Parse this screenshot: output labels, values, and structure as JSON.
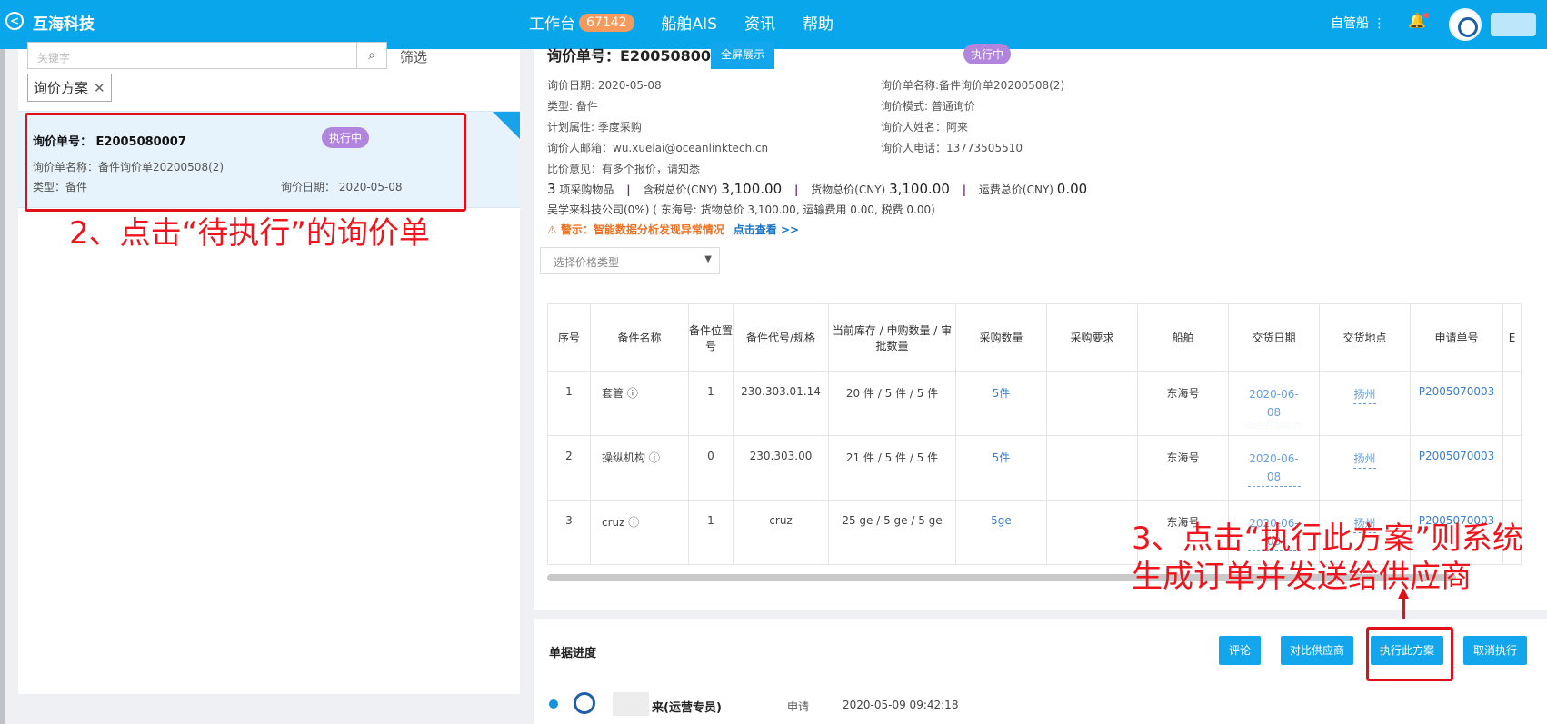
{
  "topbar": {
    "brand": "互海科技",
    "nav": [
      {
        "label": "工作台",
        "badge": "67142"
      },
      {
        "label": "船舶AIS"
      },
      {
        "label": "资讯"
      },
      {
        "label": "帮助"
      }
    ],
    "self_ship": "自管船 ⋮"
  },
  "left": {
    "search_placeholder": "关键字",
    "filter_label": "筛选",
    "tag_label": "询价方案",
    "card": {
      "no": "询价单号： E2005080007",
      "status": "执行中",
      "name": "询价单名称：备件询价单20200508(2)",
      "type": "类型：备件",
      "date": "询价日期：  2020-05-08"
    }
  },
  "annotations": {
    "step2": "2、点击“待执行”的询价单",
    "step3_line1": "3、点击“执行此方案”则系统",
    "step3_line2": "生成订单并发送给供应商"
  },
  "detail": {
    "no": "询价单号：E2005080007",
    "fullscreen": "全屏展示",
    "status": "执行中",
    "date": "询价日期:   2020-05-08",
    "form_name": "询价单名称:备件询价单20200508(2)",
    "type": "类型:  备件",
    "mode": "询价模式:  普通询价",
    "plan": "计划属性:  季度采购",
    "inquirer": "询价人姓名：阿来",
    "email": "询价人邮箱：wu.xuelai@oceanlinktech.cn",
    "phone": "询价人电话：13773505510",
    "opinion": "比价意见：有多个报价，请知悉",
    "totals": {
      "items_count": "3",
      "items_label": "项采购物品",
      "tax_label": "含税总价(CNY)",
      "tax_value": "3,100.00",
      "goods_label": "货物总价(CNY)",
      "goods_value": "3,100.00",
      "freight_label": "运费总价(CNY)",
      "freight_value": "0.00"
    },
    "supplier_line": "吴学来科技公司(0%) ( 东海号: 货物总价  3,100.00, 运输费用  0.00, 税费  0.00)",
    "warning": "⚠ 警示：智能数据分析发现异常情况",
    "warning_link": "点击查看 >>",
    "price_type_placeholder": "选择价格类型"
  },
  "table": {
    "headers": [
      "序号",
      "备件名称",
      "备件位置号",
      "备件代号/规格",
      "当前库存 / 申购数量 / 审批数量",
      "采购数量",
      "采购要求",
      "船舶",
      "交货日期",
      "交货地点",
      "申请单号",
      "E"
    ],
    "rows": [
      {
        "idx": "1",
        "name": "套管 ⓘ",
        "pos": "1",
        "code": "230.303.01.14",
        "stock": "20 件 / 5 件 / 5 件",
        "qty": "5件",
        "req": "",
        "ship": "东海号",
        "date": "2020-06-08",
        "place": "扬州",
        "apply": "P2005070003"
      },
      {
        "idx": "2",
        "name": "操纵机构 ⓘ",
        "pos": "0",
        "code": "230.303.00",
        "stock": "21 件 / 5 件 / 5 件",
        "qty": "5件",
        "req": "",
        "ship": "东海号",
        "date": "2020-06-08",
        "place": "扬州",
        "apply": "P2005070003"
      },
      {
        "idx": "3",
        "name": "cruz ⓘ",
        "pos": "1",
        "code": "cruz",
        "stock": "25 ge / 5 ge / 5 ge",
        "qty": "5ge",
        "req": "",
        "ship": "东海号",
        "date": "2020-06-08",
        "place": "扬州",
        "apply": "P2005070003"
      }
    ]
  },
  "progress": {
    "title": "单据进度",
    "buttons": {
      "comment": "评论",
      "compare": "对比供应商",
      "execute": "执行此方案",
      "cancel": "取消执行"
    },
    "entry": {
      "name": "来(运营专员)",
      "action": "申请",
      "time": "2020-05-09 09:42:18"
    }
  },
  "colors": {
    "topbar": "#0aa6ec",
    "accent": "#14a6ec",
    "status_purple": "#b184de",
    "annotation_red": "#e0101b"
  }
}
